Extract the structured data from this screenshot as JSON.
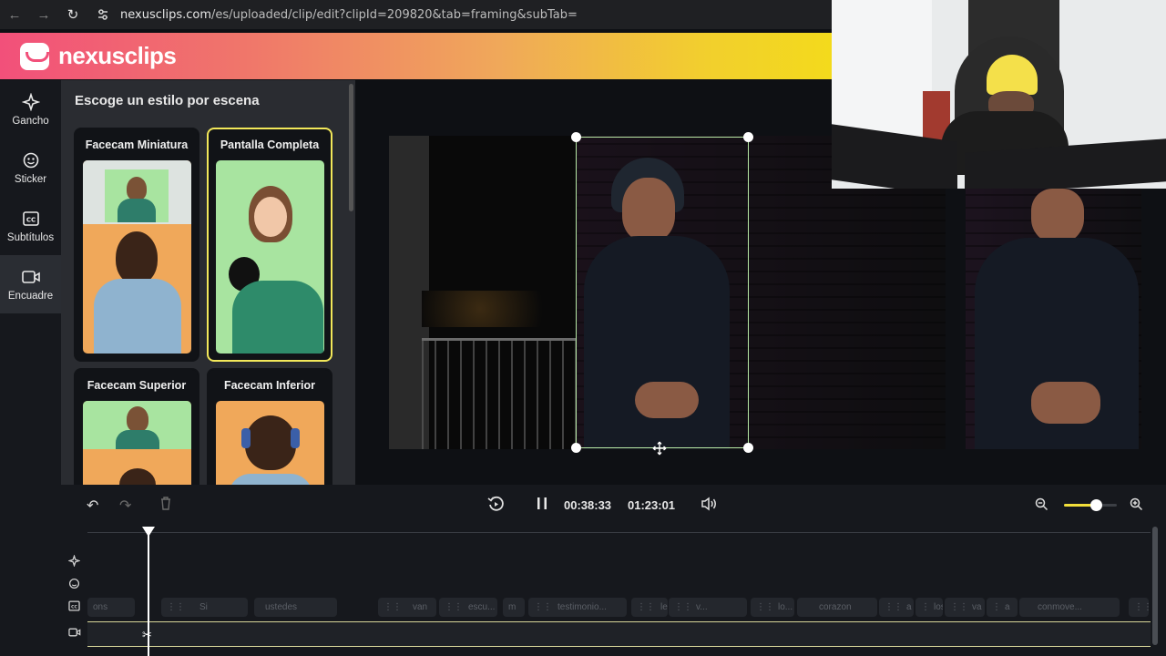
{
  "browser": {
    "url_host": "nexusclips.com",
    "url_path": "/es/uploaded/clip/edit?clipId=209820&tab=framing&subTab="
  },
  "app": {
    "brand": "nexusclips",
    "accent": "#f3e85a"
  },
  "sidebar": {
    "items": [
      {
        "label": "Gancho",
        "icon": "sparkle-icon"
      },
      {
        "label": "Sticker",
        "icon": "sticker-icon"
      },
      {
        "label": "Subtítulos",
        "icon": "cc-icon"
      },
      {
        "label": "Encuadre",
        "icon": "video-camera-icon"
      }
    ]
  },
  "panel": {
    "title": "Escoge un estilo por escena",
    "styles": [
      {
        "label": "Facecam Miniatura"
      },
      {
        "label": "Pantalla Completa"
      },
      {
        "label": "Facecam Superior"
      },
      {
        "label": "Facecam Inferior"
      }
    ]
  },
  "player": {
    "current_time": "00:38:33",
    "total_time": "01:23:01",
    "zoom_level": 0.6
  },
  "timeline": {
    "subtitles": [
      {
        "text": "ons"
      },
      {
        "text": "Si"
      },
      {
        "text": "ustedes"
      },
      {
        "text": "van"
      },
      {
        "text": "escu..."
      },
      {
        "text": "m"
      },
      {
        "text": "testimonio..."
      },
      {
        "text": "les"
      },
      {
        "text": "v..."
      },
      {
        "text": "lo..."
      },
      {
        "text": "corazon"
      },
      {
        "text": "a"
      },
      {
        "text": "los"
      },
      {
        "text": "va"
      },
      {
        "text": "a"
      },
      {
        "text": "conmove..."
      }
    ]
  }
}
